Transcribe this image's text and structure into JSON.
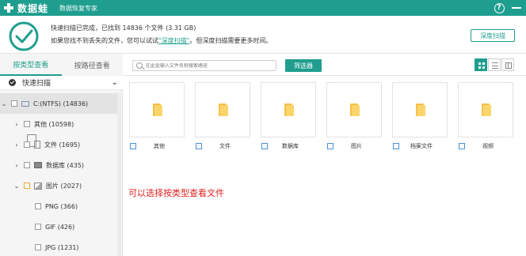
{
  "titlebar": {
    "app_name": "数据蛙",
    "subtitle": "数据恢复专家",
    "help_icon": "help-icon",
    "minimize_icon": "minimize-icon"
  },
  "status": {
    "line1": "快速扫描已完成，已找到 14836 个文件 (3.31 GB)",
    "line2_prefix": "如果您找不到丢失的文件，您可以试试",
    "line2_link": "\"深度扫描\"",
    "line2_suffix": "。但深度扫描需要更多时间。",
    "deep_scan_button": "深度扫描"
  },
  "sidebar": {
    "tabs": [
      {
        "label": "按类型查看",
        "active": true
      },
      {
        "label": "按路径查看",
        "active": false
      }
    ],
    "quick_scan_label": "快速扫描",
    "tree": [
      {
        "label": "C:(NTFS) (14836)",
        "icon": "drive-icon",
        "arrow": "⌄",
        "indent": 0,
        "selected": true
      },
      {
        "label": "其他 (10598)",
        "icon": "folder-icon",
        "arrow": "›",
        "indent": 1
      },
      {
        "label": "文件 (1695)",
        "icon": "document-icon",
        "arrow": "›",
        "indent": 1
      },
      {
        "label": "数据库 (435)",
        "icon": "database-icon",
        "arrow": "›",
        "indent": 1
      },
      {
        "label": "图片 (2027)",
        "icon": "image-icon",
        "arrow": "⌄",
        "indent": 1,
        "orange": true
      },
      {
        "label": "PNG (366)",
        "icon": "",
        "arrow": "",
        "indent": 2
      },
      {
        "label": "GIF (426)",
        "icon": "",
        "arrow": "",
        "indent": 2
      },
      {
        "label": "JPG (1231)",
        "icon": "",
        "arrow": "",
        "indent": 2
      }
    ]
  },
  "toolbar": {
    "search_placeholder": "在此处输入文件名称搜索路径",
    "filter_button": "筛选器",
    "view_modes": [
      "grid",
      "list",
      "detail"
    ],
    "active_view": "grid"
  },
  "content": {
    "items": [
      {
        "label": "其他"
      },
      {
        "label": "文件"
      },
      {
        "label": "数据库"
      },
      {
        "label": "图片"
      },
      {
        "label": "档案文件"
      },
      {
        "label": "视频"
      }
    ],
    "hint": "可以选择按类型查看文件"
  },
  "colors": {
    "accent": "#1f9e8f",
    "folder": "#f5c04a",
    "hint": "#e02020"
  }
}
